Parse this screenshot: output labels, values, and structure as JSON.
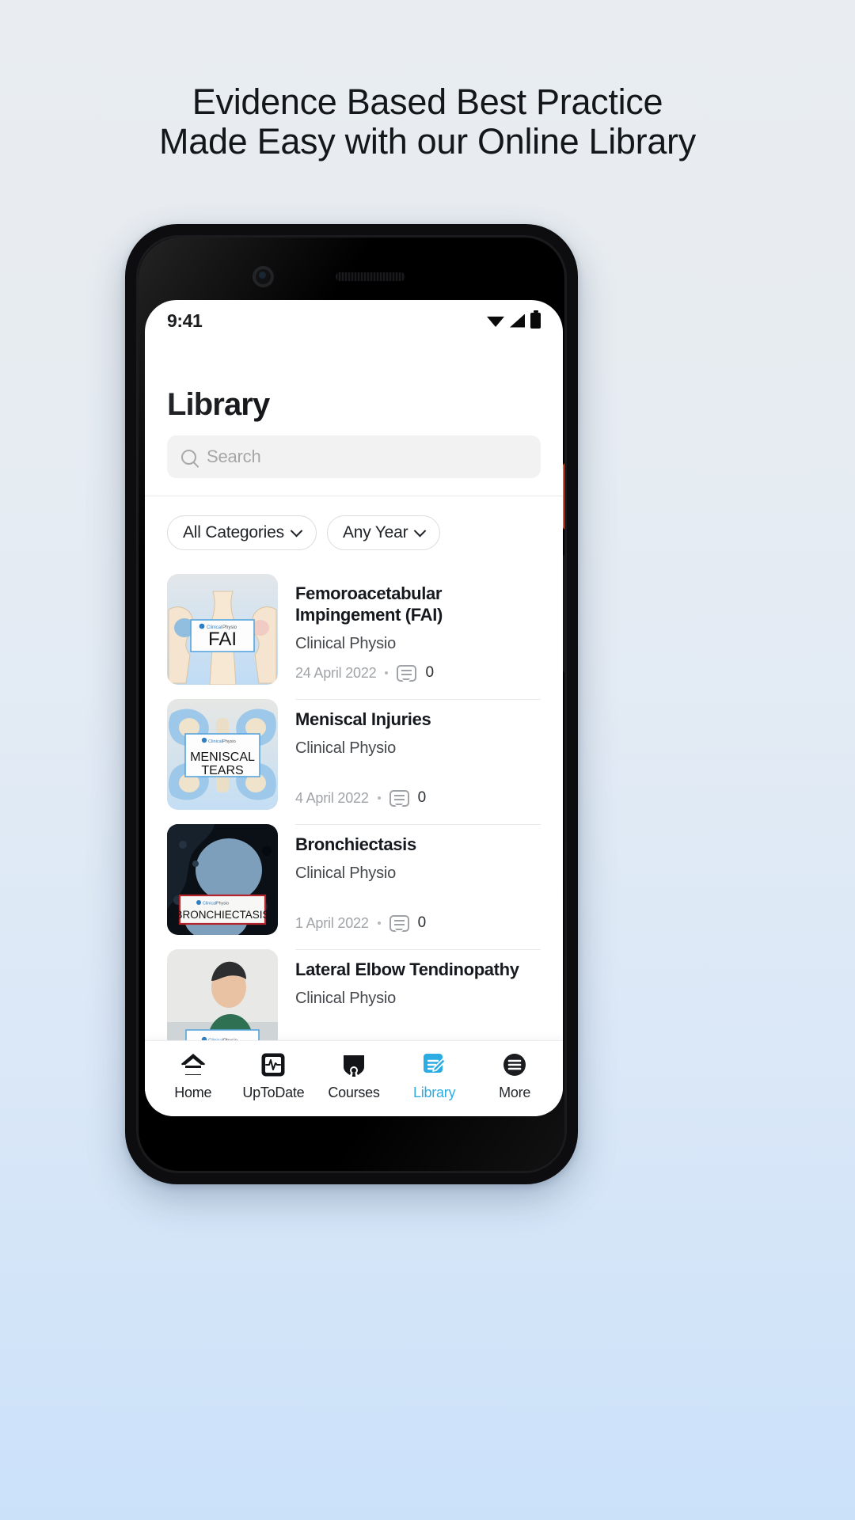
{
  "promo": {
    "headline_line1": "Evidence Based Best Practice",
    "headline_line2": "Made Easy with our Online Library"
  },
  "status_bar": {
    "time": "9:41",
    "icons": [
      "wifi-icon",
      "cellular-signal-icon",
      "battery-icon"
    ]
  },
  "screen": {
    "page_title": "Library",
    "search": {
      "placeholder": "Search",
      "value": "",
      "icon": "search-icon"
    },
    "filters": [
      {
        "label": "All Categories",
        "icon": "chevron-down-icon"
      },
      {
        "label": "Any Year",
        "icon": "chevron-down-icon"
      }
    ],
    "articles": [
      {
        "title": "Femoroacetabular Impingement (FAI)",
        "author": "Clinical Physio",
        "date": "24 April 2022",
        "comments": "0",
        "comment_icon": "comment-icon",
        "thumb_label": "FAI",
        "thumb_brand": "Clinical Physio",
        "thumb_alt": "hip-anatomy-illustration"
      },
      {
        "title": "Meniscal Injuries",
        "author": "Clinical Physio",
        "date": "4 April 2022",
        "comments": "0",
        "comment_icon": "comment-icon",
        "thumb_label": "MENISCAL TEARS",
        "thumb_brand": "Clinical Physio",
        "thumb_alt": "meniscus-cartilage-illustration"
      },
      {
        "title": "Bronchiectasis",
        "author": "Clinical Physio",
        "date": "1 April 2022",
        "comments": "0",
        "comment_icon": "comment-icon",
        "thumb_label": "BRONCHIECTASIS",
        "thumb_brand": "Clinical Physio",
        "thumb_alt": "lung-ct-scan-image"
      },
      {
        "title": "Lateral Elbow Tendinopathy",
        "author": "Clinical Physio",
        "date": "",
        "comments": "",
        "comment_icon": "comment-icon",
        "thumb_label": "",
        "thumb_brand": "Clinical Physio",
        "thumb_alt": "clinician-portrait-photo"
      }
    ],
    "bottom_nav": [
      {
        "label": "Home",
        "icon": "home-icon",
        "active": false
      },
      {
        "label": "UpToDate",
        "icon": "monitor-pulse-icon",
        "active": false
      },
      {
        "label": "Courses",
        "icon": "graduation-cap-icon",
        "active": false
      },
      {
        "label": "Library",
        "icon": "edit-document-icon",
        "active": true
      },
      {
        "label": "More",
        "icon": "menu-circle-icon",
        "active": false
      }
    ]
  },
  "colors": {
    "accent": "#2aabe2",
    "text_primary": "#15181c",
    "text_muted": "#a0a3a7",
    "page_bg_top": "#e9edf1",
    "page_bg_bottom": "#cbe1fa"
  }
}
